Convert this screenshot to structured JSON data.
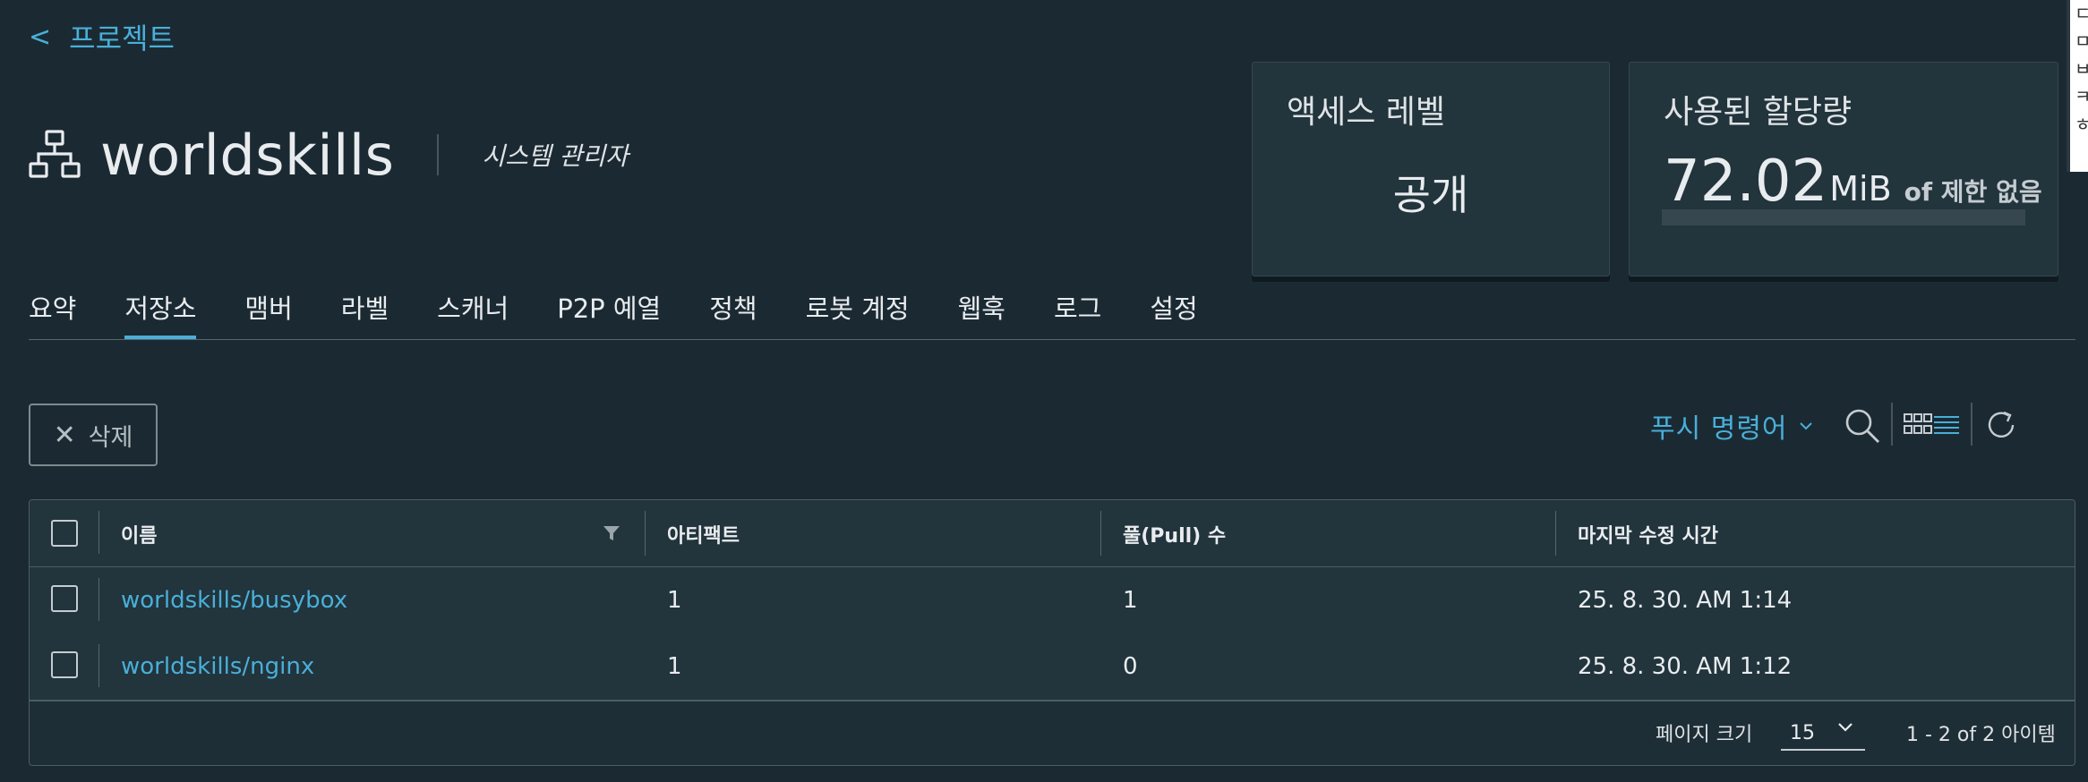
{
  "back": {
    "chevron": "<",
    "label": "프로젝트"
  },
  "project": {
    "name": "worldskills",
    "role": "시스템 관리자",
    "icon": "project-icon"
  },
  "cards": {
    "access": {
      "title": "액세스 레벨",
      "value": "공개"
    },
    "quota": {
      "title": "사용된 할당량",
      "number": "72.02",
      "unit": "MiB",
      "of": "of 제한 없음",
      "used_fraction": 0
    }
  },
  "tabs": [
    {
      "label": "요약",
      "active": false
    },
    {
      "label": "저장소",
      "active": true
    },
    {
      "label": "맴버",
      "active": false
    },
    {
      "label": "라벨",
      "active": false
    },
    {
      "label": "스캐너",
      "active": false
    },
    {
      "label": "P2P 예열",
      "active": false
    },
    {
      "label": "정책",
      "active": false
    },
    {
      "label": "로봇 계정",
      "active": false
    },
    {
      "label": "웹훅",
      "active": false
    },
    {
      "label": "로그",
      "active": false
    },
    {
      "label": "설정",
      "active": false
    }
  ],
  "toolbar": {
    "delete_label": "삭제",
    "push_label": "푸시 명령어"
  },
  "table": {
    "columns": [
      "이름",
      "아티팩트",
      "풀(Pull) 수",
      "마지막 수정 시간"
    ],
    "rows": [
      {
        "name": "worldskills/busybox",
        "artifacts": "1",
        "pulls": "1",
        "modified": "25. 8. 30. AM 1:14"
      },
      {
        "name": "worldskills/nginx",
        "artifacts": "1",
        "pulls": "0",
        "modified": "25. 8. 30. AM 1:12"
      }
    ],
    "footer": {
      "page_size_label": "페이지 크기",
      "page_size": "15",
      "range": "1 - 2 of 2 아이템"
    }
  },
  "edge_popup": [
    "ㄷ",
    "ㅁ",
    "ㅂ",
    "ㅋ",
    "ㅎ"
  ],
  "colors": {
    "accent": "#49afd9",
    "background": "#1b2a32",
    "card": "#22343c"
  }
}
